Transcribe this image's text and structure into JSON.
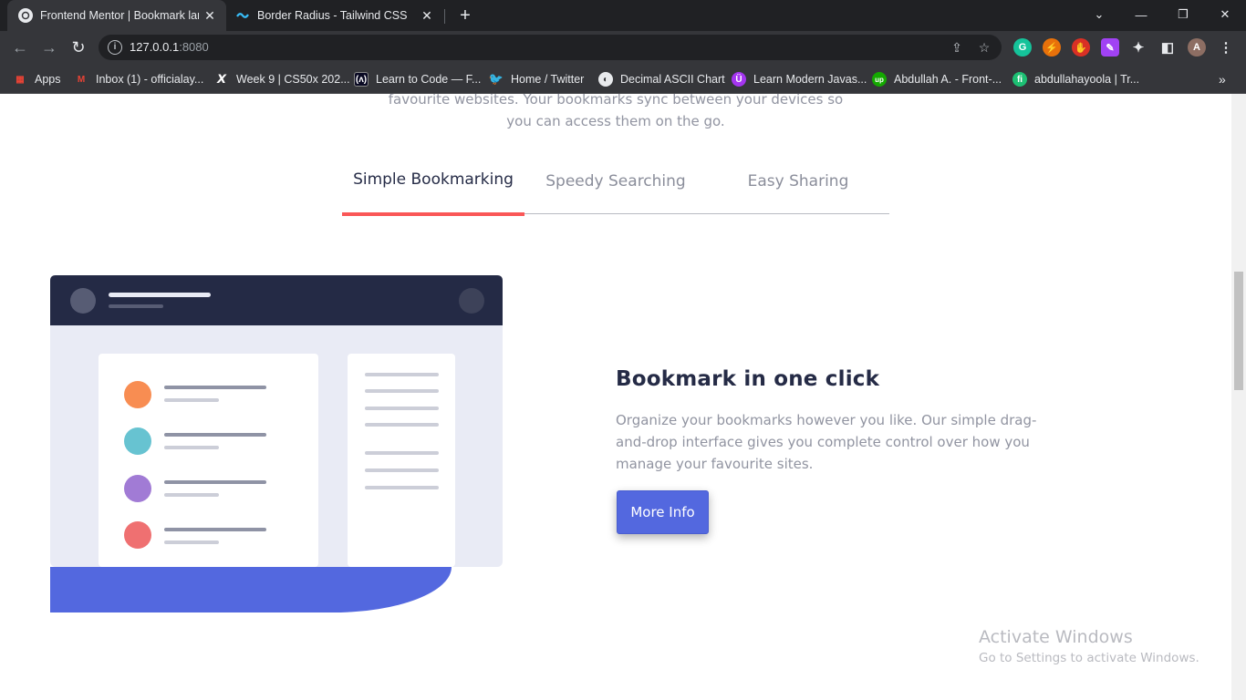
{
  "browser": {
    "tabs": [
      {
        "title": "Frontend Mentor | Bookmark landing page",
        "active": true
      },
      {
        "title": "Border Radius - Tailwind CSS",
        "active": false
      }
    ],
    "url_host": "127.0.0.1",
    "url_port": ":8080",
    "bookmarks": [
      {
        "label": "Apps",
        "icon": "apps-grid-icon"
      },
      {
        "label": "Inbox (1) - officialay...",
        "icon": "gmail-icon"
      },
      {
        "label": "Week 9 | CS50x 202...",
        "icon": "x-icon"
      },
      {
        "label": "Learn to Code — F...",
        "icon": "freecodecamp-icon"
      },
      {
        "label": "Home / Twitter",
        "icon": "twitter-icon"
      },
      {
        "label": "Decimal ASCII Chart",
        "icon": "globe-icon"
      },
      {
        "label": "Learn Modern Javas...",
        "icon": "udemy-icon"
      },
      {
        "label": "Abdullah A. - Front-...",
        "icon": "upwork-icon"
      },
      {
        "label": "abdullahayoola | Tr...",
        "icon": "fiverr-icon"
      }
    ]
  },
  "page": {
    "intro_line1": "favourite websites. Your bookmarks sync between your devices so",
    "intro_line2": "you can access them on the go.",
    "feature_tabs": [
      {
        "label": "Simple Bookmarking",
        "active": true
      },
      {
        "label": "Speedy Searching",
        "active": false
      },
      {
        "label": "Easy Sharing",
        "active": false
      }
    ],
    "feature": {
      "title": "Bookmark in one click",
      "description": "Organize your bookmarks however you like. Our simple drag-and-drop interface gives you complete control over how you manage your favourite sites.",
      "button": "More Info"
    },
    "colors": {
      "accent": "#5368df",
      "tab_underline": "#fa5757",
      "dark": "#252b46"
    }
  },
  "os_watermark": {
    "line1": "Activate Windows",
    "line2": "Go to Settings to activate Windows."
  }
}
